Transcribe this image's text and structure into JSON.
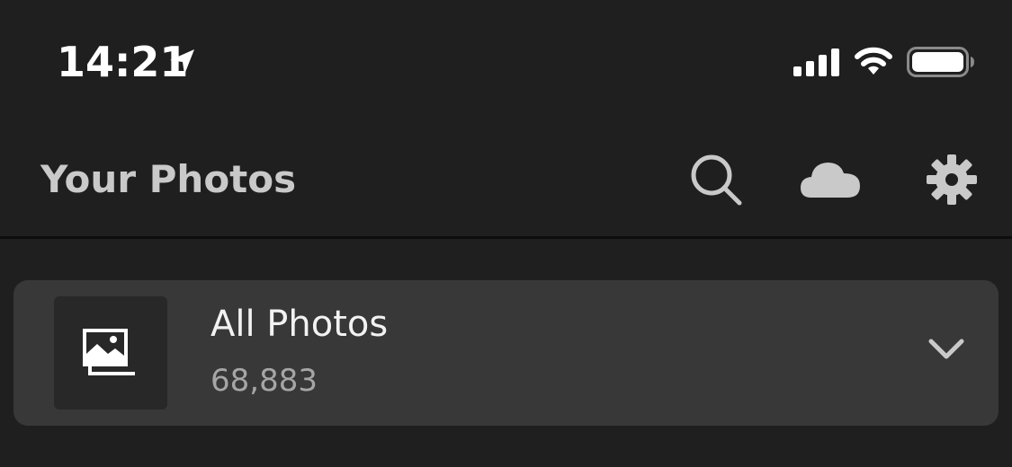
{
  "status_bar": {
    "time": "14:21",
    "icons": [
      "location-arrow-icon",
      "cellular-signal-icon",
      "wifi-icon",
      "battery-icon"
    ]
  },
  "header": {
    "title": "Your Photos",
    "actions": [
      "search-icon",
      "cloud-icon",
      "gear-icon"
    ]
  },
  "album": {
    "name": "All Photos",
    "count": "68,883",
    "icon": "photos-stack-icon",
    "expand_icon": "chevron-down-icon"
  },
  "colors": {
    "background": "#1f1f1f",
    "card": "#383838",
    "thumb": "#282828",
    "title": "#c9c9c9",
    "secondary_text": "#a6a6a6"
  }
}
